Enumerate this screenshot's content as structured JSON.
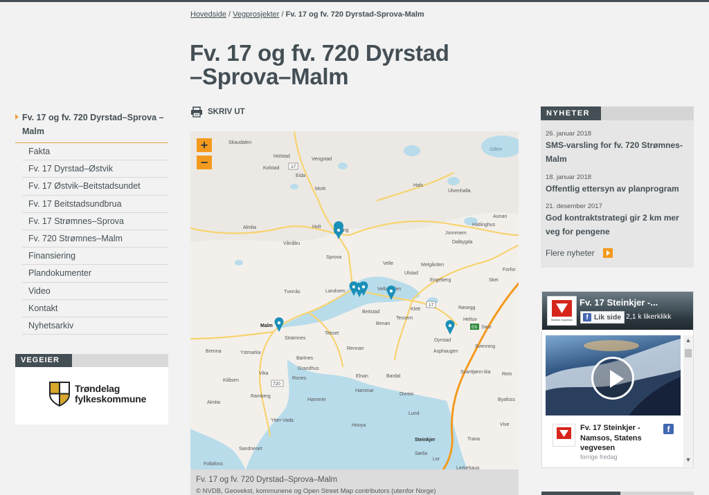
{
  "breadcrumb": {
    "home": "Hovedside",
    "sep1": " / ",
    "projects": "Vegprosjekter",
    "sep2": " / ",
    "current": "Fv. 17 og fv. 720 Dyrstad-Sprova-Malm"
  },
  "page": {
    "title": "Fv. 17 og fv. 720 Dyrstad\n–Sprova–Malm"
  },
  "leftnav": {
    "active": "Fv. 17 og fv. 720 Dyrstad–Sprova –Malm",
    "items": [
      {
        "label": "Fakta"
      },
      {
        "label": "Fv. 17 Dyrstad–Østvik"
      },
      {
        "label": "Fv. 17 Østvik–Beitstadsundet"
      },
      {
        "label": "Fv. 17 Beitstadsundbrua"
      },
      {
        "label": "Fv. 17 Strømnes–Sprova"
      },
      {
        "label": "Fv. 720 Strømnes–Malm"
      },
      {
        "label": "Finansiering"
      },
      {
        "label": "Plandokumenter"
      },
      {
        "label": "Video"
      },
      {
        "label": "Kontakt"
      },
      {
        "label": "Nyhetsarkiv"
      }
    ]
  },
  "vegeier": {
    "label": "VEGEIER",
    "owner_line1": "Trøndelag",
    "owner_line2": "fylkeskommune"
  },
  "toolbar": {
    "print_label": "SKRIV UT"
  },
  "map": {
    "zoom_in": "+",
    "zoom_out": "−",
    "caption": "Fv. 17 og fv. 720 Dyrstad–Sprova–Malm",
    "credit": "© NVDB, Geovekst, kommunene og Open Street Map contributors (utenfor Norge)",
    "places": [
      "Skaudalen",
      "Holstad",
      "Vengstad",
      "Gilten",
      "Kolstad",
      "Eida",
      "Mork",
      "Hals",
      "Ulvenhalla",
      "Aunan",
      "Almlia",
      "Holt",
      "Tørring",
      "Jonnmem",
      "Hatlinghus",
      "Vånåbu",
      "Sprova",
      "Dalbygda",
      "Velle",
      "Melgården",
      "Forfor",
      "Ulstad",
      "Engeberg",
      "Skei",
      "Tverrås",
      "Landsem",
      "Vellamelen",
      "Klett",
      "Røsegg",
      "Beitstad",
      "Tessem",
      "Heltuv",
      "Benan",
      "Saur",
      "Malm",
      "Strømnes",
      "Tekset",
      "Dyrstad",
      "Svenning",
      "Brenna",
      "Ystmarka",
      "Rennan",
      "Asphaugen",
      "Bartnes",
      "Grandhus",
      "Svarttjønn-bia",
      "Rein",
      "Kilåsen",
      "Vika",
      "Rones",
      "Elnan",
      "Bardal",
      "Ramberg",
      "Hammar",
      "Ovrein",
      "Byafoss",
      "Almlia",
      "Hammer",
      "Lund",
      "Ytter-Vada",
      "Hooya",
      "Vive",
      "Steinkjer",
      "Trana",
      "Sandneset",
      "Sørlia",
      "Follafoss",
      "Ler",
      "Lerkehaug"
    ],
    "road_numbers": [
      "17",
      "17",
      "720",
      "E6"
    ],
    "colors": {
      "water": "#b9dceb",
      "land": "#f3f0ec",
      "road_major": "#f7d36e",
      "road_european": "#f39a1e",
      "pin": "#1a8fb8"
    }
  },
  "news": {
    "label": "NYHETER",
    "items": [
      {
        "date": "26. januar 2018",
        "title": "SMS-varsling for fv. 720 Strømnes-Malm"
      },
      {
        "date": "18. januar 2018",
        "title": "Offentlig ettersyn av planprogram"
      },
      {
        "date": "21. desember 2017",
        "title": "God kontraktstrategi gir 2 km mer veg for pengene"
      }
    ],
    "more": "Flere nyheter"
  },
  "facebook": {
    "page_name": "Fv. 17 Steinkjer -...",
    "like_label": "Lik side",
    "likes": "2,1 k likerklikk",
    "post_title": "Fv. 17 Steinkjer - Namsos, Statens vegvesen",
    "post_time": "forrige fredag",
    "avatar_text": "Statens vegvesen",
    "f_icon": "f"
  }
}
